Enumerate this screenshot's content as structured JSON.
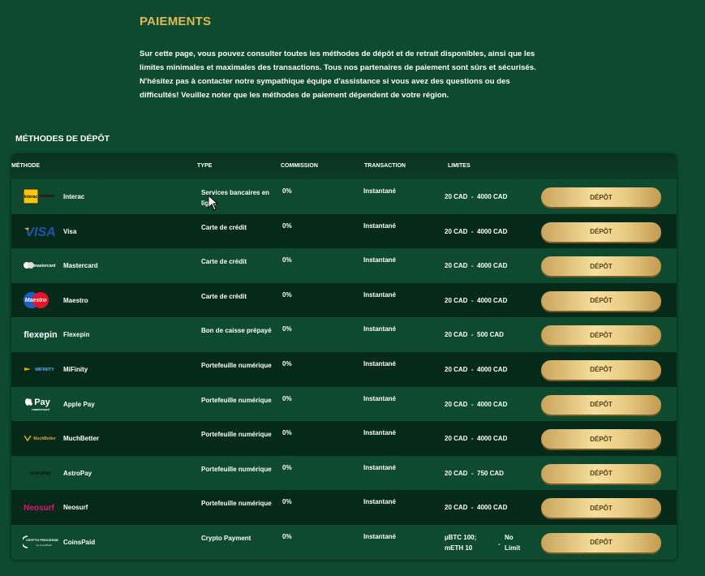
{
  "page": {
    "title": "PAIEMENTS",
    "intro": "Sur cette page, vous pouvez consulter toutes les méthodes de dépôt et de retrait disponibles, ainsi que les limites minimales et maximales des transactions. Tous nos partenaires de paiement sont sûrs et sécurisés. N'hésitez pas à contacter notre sympathique équipe d'assistance si vous avez des questions ou des difficultés! Veuillez noter que les méthodes de paiement dépendent de votre région.",
    "section_title": "MÉTHODES DE DÉPÔT"
  },
  "table": {
    "headers": {
      "method": "MÉTHODE",
      "type": "TYPE",
      "commission": "COMMISSION",
      "transaction": "TRANSACTION",
      "limits": "LIMITES"
    },
    "rows": [
      {
        "icon": "interac-logo",
        "name": "Interac",
        "type": "Services bancaires en ligne",
        "commission": "0%",
        "transaction": "Instantané",
        "limits": "20 CAD  -  4000 CAD",
        "button": "DÉPÔT"
      },
      {
        "icon": "visa-logo",
        "name": "Visa",
        "type": "Carte de crédit",
        "commission": "0%",
        "transaction": "Instantané",
        "limits": "20 CAD  -  4000 CAD",
        "button": "DÉPÔT"
      },
      {
        "icon": "mastercard-logo",
        "name": "Mastercard",
        "type": "Carte de crédit",
        "commission": "0%",
        "transaction": "Instantané",
        "limits": "20 CAD  -  4000 CAD",
        "button": "DÉPÔT"
      },
      {
        "icon": "maestro-logo",
        "name": "Maestro",
        "type": "Carte de crédit",
        "commission": "0%",
        "transaction": "Instantané",
        "limits": "20 CAD  -  4000 CAD",
        "button": "DÉPÔT"
      },
      {
        "icon": "flexepin-logo",
        "name": "Flexepin",
        "type": "Bon de caisse prépayé",
        "commission": "0%",
        "transaction": "Instantané",
        "limits": "20 CAD  -  500 CAD",
        "button": "DÉPÔT"
      },
      {
        "icon": "mifinity-logo",
        "name": "MiFinity",
        "type": "Portefeuille numérique",
        "commission": "0%",
        "transaction": "Instantané",
        "limits": "20 CAD  -  4000 CAD",
        "button": "DÉPÔT"
      },
      {
        "icon": "applepay-logo",
        "name": "Apple Pay",
        "type": "Portefeuille numérique",
        "commission": "0%",
        "transaction": "Instantané",
        "limits": "20 CAD  -  4000 CAD",
        "button": "DÉPÔT"
      },
      {
        "icon": "muchbetter-logo",
        "name": "MuchBetter",
        "type": "Portefeuille numérique",
        "commission": "0%",
        "transaction": "Instantané",
        "limits": "20 CAD  -  4000 CAD",
        "button": "DÉPÔT"
      },
      {
        "icon": "astropay-logo",
        "name": "AstroPay",
        "type": "Portefeuille numérique",
        "commission": "0%",
        "transaction": "Instantané",
        "limits": "20 CAD  -  750 CAD",
        "button": "DÉPÔT"
      },
      {
        "icon": "neosurf-logo",
        "name": "Neosurf",
        "type": "Portefeuille numérique",
        "commission": "0%",
        "transaction": "Instantané",
        "limits": "20 CAD  -  4000 CAD",
        "button": "DÉPÔT"
      },
      {
        "icon": "coinspaid-logo",
        "name": "CoinsPaid",
        "type": "Crypto Payment",
        "commission": "0%",
        "transaction": "Instantané",
        "limits_min": "µBTC 100; mETH 10",
        "limits_sep": "-",
        "limits_max": "No Limit",
        "button": "DÉPÔT"
      }
    ]
  },
  "logos": {
    "visa": "VISA",
    "mastercard": "mastercard",
    "maestro": "Maestro",
    "flexepin": "flexepin",
    "mifinity": "MIFINITY",
    "applepay": "Pay",
    "applepay_sub": "mastercard",
    "muchbetter": "MuchBetter",
    "astropay": "AstroPay",
    "neosurf": "Neosurf",
    "coinspaid": "CRYPTO PROCESSING",
    "coinspaid_sub": "by CoinsPaid",
    "interac": "Interac"
  },
  "colors": {
    "background": "#0d4a2e",
    "title": "#e0b85a",
    "button": "#f5df9e"
  }
}
